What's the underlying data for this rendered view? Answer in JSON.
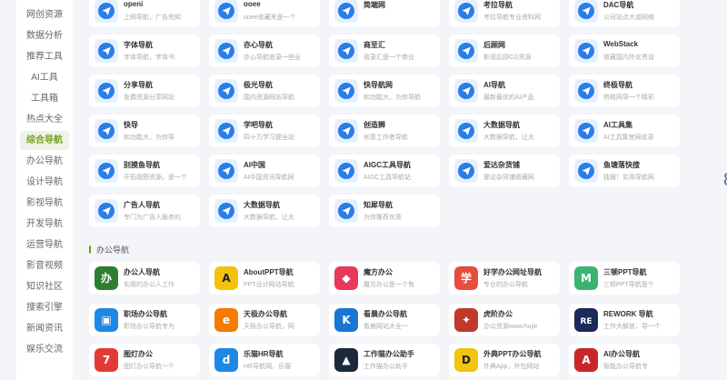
{
  "sidebar": {
    "items": [
      {
        "label": "网创资源"
      },
      {
        "label": "数据分析"
      },
      {
        "label": "推荐工具"
      },
      {
        "label": "AI工具"
      },
      {
        "label": "工具箱"
      },
      {
        "label": "热点大全"
      },
      {
        "label": "综合导航",
        "active": true
      },
      {
        "label": "办公导航"
      },
      {
        "label": "设计导航"
      },
      {
        "label": "影视导航"
      },
      {
        "label": "开发导航"
      },
      {
        "label": "运营导航"
      },
      {
        "label": "影音视频"
      },
      {
        "label": "知识社区"
      },
      {
        "label": "搜索引擎"
      },
      {
        "label": "新闻资讯"
      },
      {
        "label": "娱乐交流"
      }
    ]
  },
  "nav_cards": [
    {
      "title": "openi",
      "desc": "上网导航，广告完知"
    },
    {
      "title": "ooee",
      "desc": "ooee收藏夹是一个"
    },
    {
      "title": "简端网",
      "desc": ""
    },
    {
      "title": "考拉导航",
      "desc": "考拉导航专业资料网"
    },
    {
      "title": "DAC导航",
      "desc": "公司站点大道网络"
    },
    {
      "title": "字体导航",
      "desc": "字体导航，字体书"
    },
    {
      "title": "亦心导航",
      "desc": "亦心导航收录一些全"
    },
    {
      "title": "商至汇",
      "desc": "收录汇是一个商业"
    },
    {
      "title": "后顾网",
      "desc": "影视后顾CG资源"
    },
    {
      "title": "WebStack",
      "desc": "收藏国内外优秀设"
    },
    {
      "title": "分享导航",
      "desc": "免费资源分享网站"
    },
    {
      "title": "极光导航",
      "desc": "国内资源网站导航"
    },
    {
      "title": "快导航网",
      "desc": "如功能大，为你导航"
    },
    {
      "title": "AI导航",
      "desc": "最新最优的AI产品"
    },
    {
      "title": "终极导航",
      "desc": "热租网导一个精彩"
    },
    {
      "title": "快导",
      "desc": "如功能大，为你导"
    },
    {
      "title": "学吧导航",
      "desc": "四十万学习健全站"
    },
    {
      "title": "创造狮",
      "desc": "创意工作者导航"
    },
    {
      "title": "大数据导航",
      "desc": "大数据导航，让大"
    },
    {
      "title": "AI工具集",
      "desc": "AI工具集官网收录"
    },
    {
      "title": "别摸鱼导航",
      "desc": "开拓视野资源，是一个"
    },
    {
      "title": "AI中国",
      "desc": "AI中国资讯导航网"
    },
    {
      "title": "AIGC工具导航",
      "desc": "AIGC工具导航站"
    },
    {
      "title": "爱达杂货铺",
      "desc": "爱达杂货铺收藏网"
    },
    {
      "title": "鱼塘落快搜",
      "desc": "独搜！实用导航网"
    },
    {
      "title": "广告人导航",
      "desc": "专门为广告人服务的"
    },
    {
      "title": "大数据导航",
      "desc": "大数据导航，让大"
    },
    {
      "title": "知犀导航",
      "desc": "为你推荐优质"
    }
  ],
  "section": {
    "title": "办公导航"
  },
  "office_cards": [
    {
      "title": "办公人导航",
      "desc": "实用的办公人工作",
      "icon": "office-person-icon",
      "color": "#2e7d32"
    },
    {
      "title": "AboutPPT导航",
      "desc": "PPT设计网站导航",
      "icon": "aboutppt-icon",
      "color": "#f4c20d"
    },
    {
      "title": "魔方办公",
      "desc": "魔方办公是一个有",
      "icon": "mofang-icon",
      "color": "#e8395b"
    },
    {
      "title": "好学办公网址导航",
      "desc": "专业的办公导航",
      "icon": "xue-icon",
      "color": "#e84c3d"
    },
    {
      "title": "三顿PPT导航",
      "desc": "三顿PPT导航是个",
      "icon": "sandun-icon",
      "color": "#3cb371"
    },
    {
      "title": "职场办公导航",
      "desc": "职场办公导航专为",
      "icon": "office-monitor-icon",
      "color": "#1e88e5"
    },
    {
      "title": "天极办公导航",
      "desc": "天极办公导航，网",
      "icon": "tianji-e-icon",
      "color": "#f57c00"
    },
    {
      "title": "看晨办公导航",
      "desc": "看晨网站大全一",
      "icon": "kanchen-k-icon",
      "color": "#1976d2"
    },
    {
      "title": "虎阶办公",
      "desc": "办公资源www.hujie",
      "icon": "hujie-icon",
      "color": "#c0392b"
    },
    {
      "title": "REWORK 导航",
      "desc": "工作大解放，导一个",
      "icon": "rework-icon",
      "color": "#1a2a5a"
    },
    {
      "title": "图灯办公",
      "desc": "图灯办公导航一个",
      "icon": "tudeng-icon",
      "color": "#e53935"
    },
    {
      "title": "乐猫HR导航",
      "desc": "HR导航网，乐猫",
      "icon": "lemao-icon",
      "color": "#1e88e5"
    },
    {
      "title": "工作猫办公助手",
      "desc": "工作猫办公助手",
      "icon": "cat-icon",
      "color": "#1b2a3a"
    },
    {
      "title": "外典PPT办公导航",
      "desc": "外典App，外包网站",
      "icon": "waidian-icon",
      "color": "#f1c40f"
    },
    {
      "title": "AI办公导航",
      "desc": "智能办公导航专",
      "icon": "ai-office-icon",
      "color": "#c62828"
    }
  ]
}
